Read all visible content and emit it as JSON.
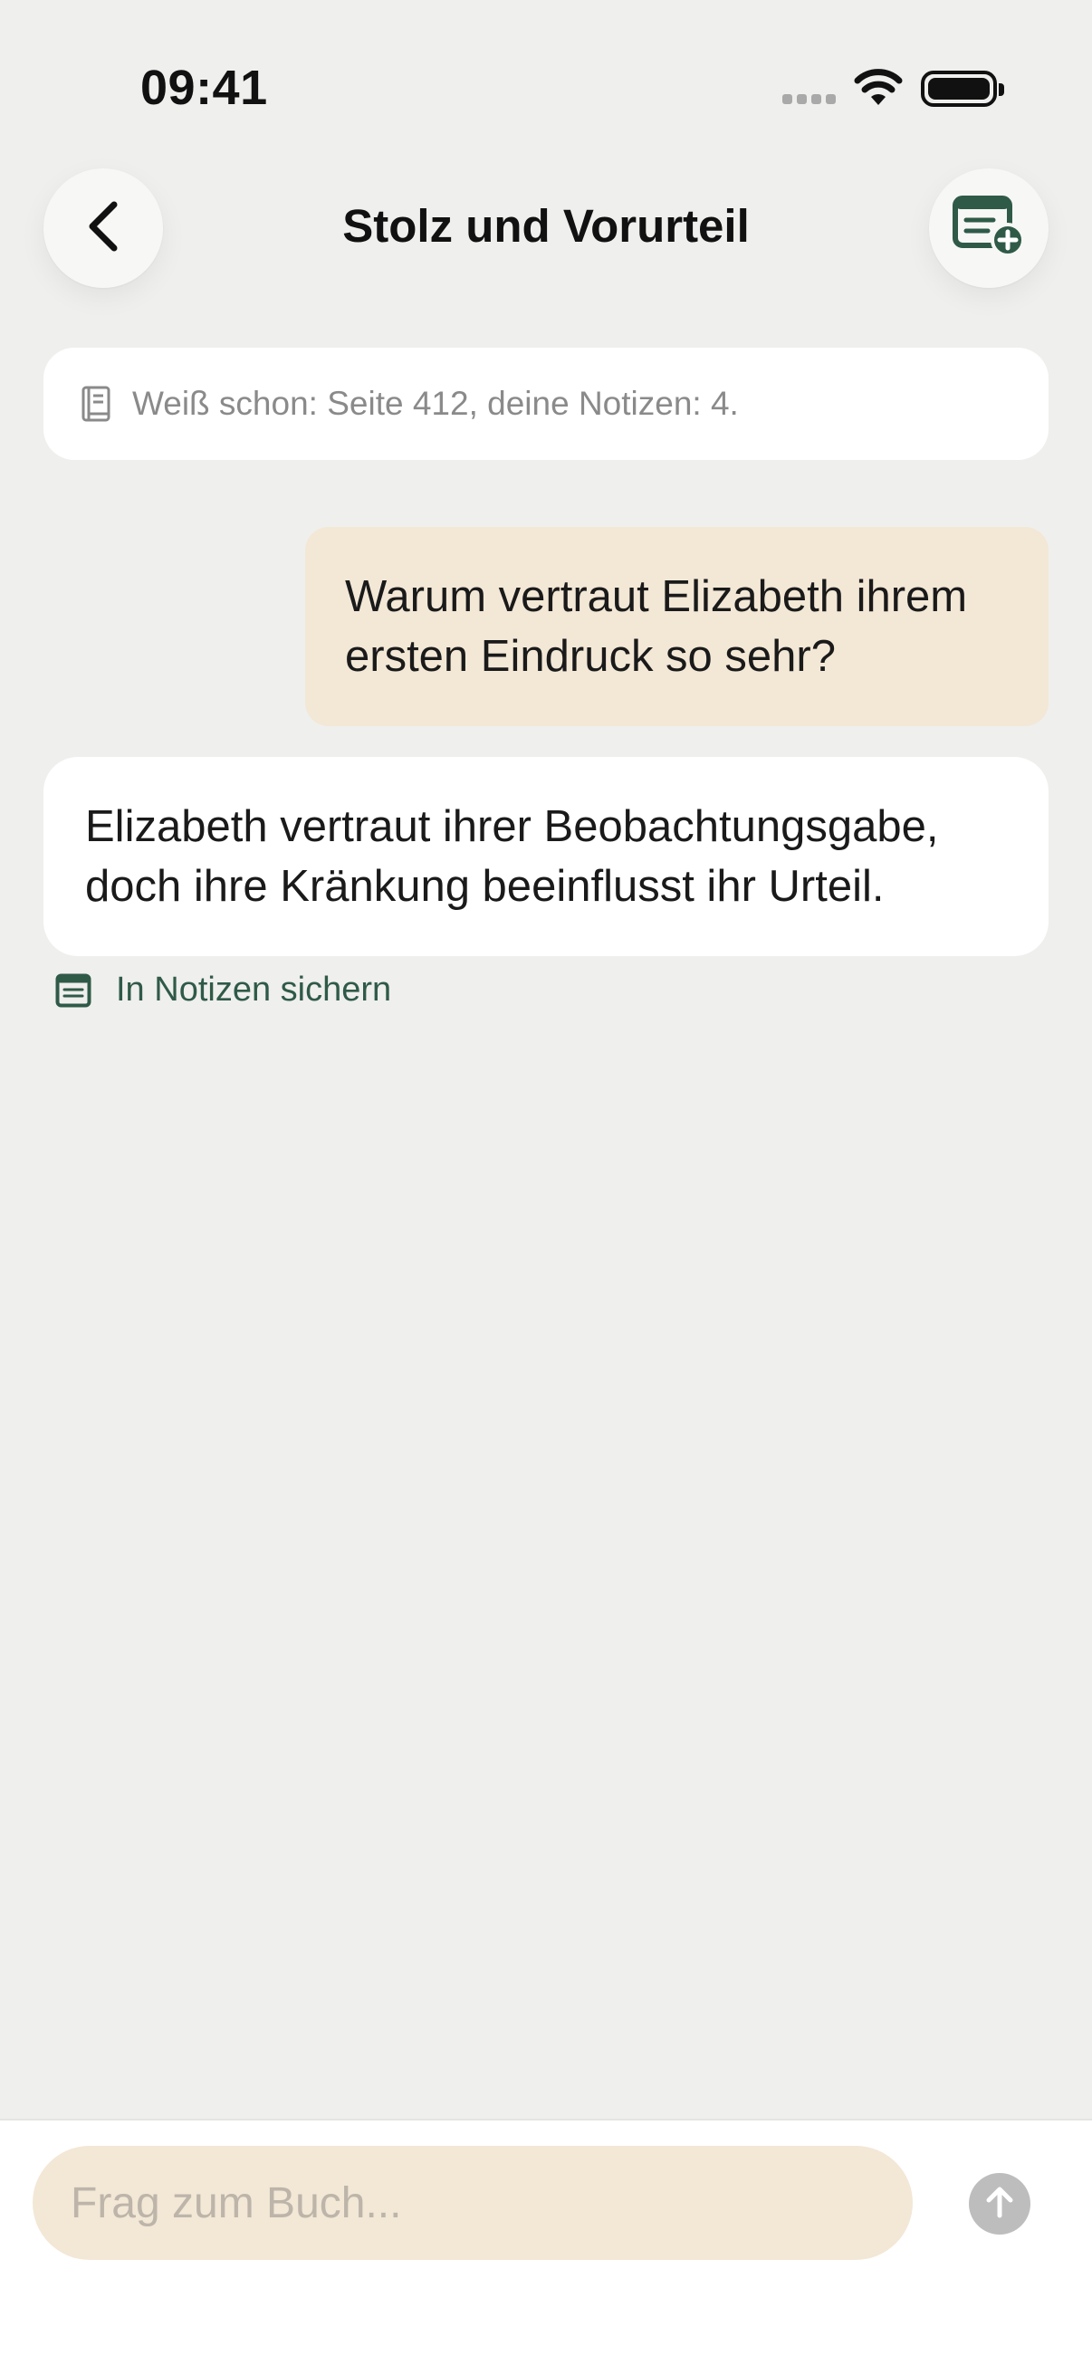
{
  "status_bar": {
    "time": "09:41"
  },
  "header": {
    "title": "Stolz und Vorurteil",
    "back_icon": "chevron-left-icon",
    "notes_icon": "note-add-icon"
  },
  "context": {
    "icon": "book-icon",
    "text": "Weiß schon: Seite 412, deine Notizen: 4."
  },
  "conversation": {
    "user_message": "Warum vertraut Elizabeth ihrem ersten Eindruck so sehr?",
    "assistant_message": "Elizabeth vertraut ihrer Beobachtungsgabe, doch ihre Kränkung beeinflusst ihr Urteil.",
    "save_action": {
      "icon": "notes-icon",
      "label": "In Notizen sichern"
    }
  },
  "composer": {
    "placeholder": "Frag zum Buch...",
    "value": "",
    "send_icon": "arrow-up-icon"
  },
  "colors": {
    "background": "#EFEFED",
    "accent_green": "#2F5A48",
    "user_bubble": "#F3E7D6",
    "card": "#FFFFFF"
  }
}
